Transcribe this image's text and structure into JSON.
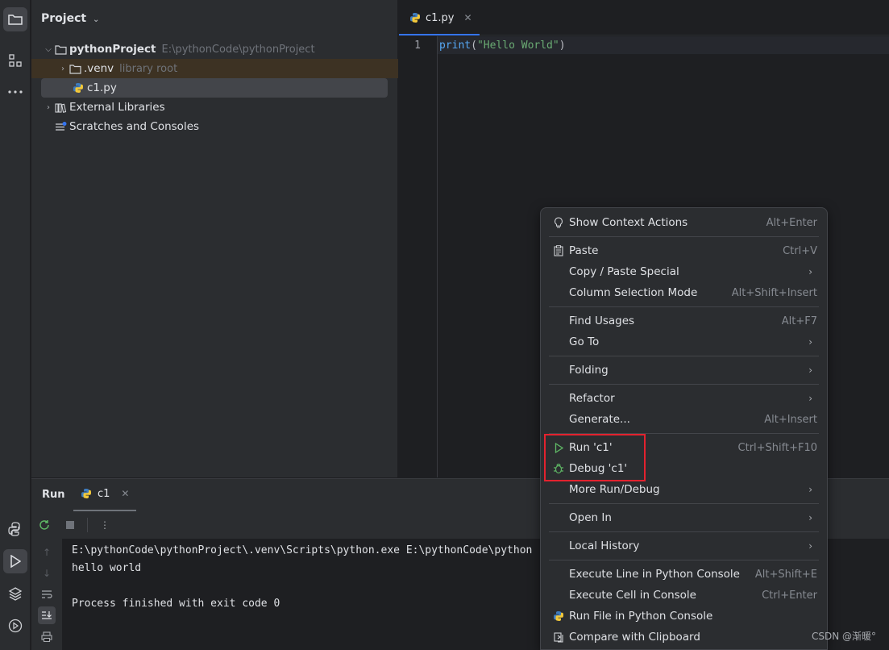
{
  "project_panel": {
    "title": "Project",
    "tree": [
      {
        "label": "pythonProject",
        "hint": "E:\\pythonCode\\pythonProject"
      },
      {
        "label": ".venv",
        "hint": "library root"
      },
      {
        "label": "c1.py",
        "hint": ""
      },
      {
        "label": "External Libraries",
        "hint": ""
      },
      {
        "label": "Scratches and Consoles",
        "hint": ""
      }
    ]
  },
  "editor": {
    "tab_label": "c1.py",
    "line_number": "1",
    "code": {
      "fn": "print",
      "open": "(",
      "str": "\"Hello World\"",
      "close": ")"
    }
  },
  "run_panel": {
    "title": "Run",
    "tab_label": "c1",
    "console": [
      "E:\\pythonCode\\pythonProject\\.venv\\Scripts\\python.exe E:\\pythonCode\\python",
      "hello world",
      "",
      "Process finished with exit code 0"
    ]
  },
  "context_menu": {
    "items": [
      {
        "label": "Show Context Actions",
        "shortcut": "Alt+Enter",
        "icon": "bulb-icon"
      },
      {
        "label": "Paste",
        "shortcut": "Ctrl+V",
        "icon": "clipboard-icon"
      },
      {
        "label": "Copy / Paste Special",
        "submenu": true
      },
      {
        "label": "Column Selection Mode",
        "shortcut": "Alt+Shift+Insert"
      },
      {
        "label": "Find Usages",
        "shortcut": "Alt+F7"
      },
      {
        "label": "Go To",
        "submenu": true
      },
      {
        "label": "Folding",
        "submenu": true
      },
      {
        "label": "Refactor",
        "submenu": true
      },
      {
        "label": "Generate...",
        "shortcut": "Alt+Insert"
      },
      {
        "label": "Run 'c1'",
        "shortcut": "Ctrl+Shift+F10",
        "icon": "run-icon"
      },
      {
        "label": "Debug 'c1'",
        "icon": "debug-icon"
      },
      {
        "label": "More Run/Debug",
        "submenu": true
      },
      {
        "label": "Open In",
        "submenu": true
      },
      {
        "label": "Local History",
        "submenu": true
      },
      {
        "label": "Execute Line in Python Console",
        "shortcut": "Alt+Shift+E"
      },
      {
        "label": "Execute Cell in Console",
        "shortcut": "Ctrl+Enter"
      },
      {
        "label": "Run File in Python Console",
        "icon": "python-icon"
      },
      {
        "label": "Compare with Clipboard",
        "icon": "compare-icon"
      }
    ]
  },
  "watermark": "CSDN @渐暖°",
  "colors": {
    "accent": "#3574f0",
    "highlight_box": "#e3222e",
    "run_green": "#5fb865"
  }
}
